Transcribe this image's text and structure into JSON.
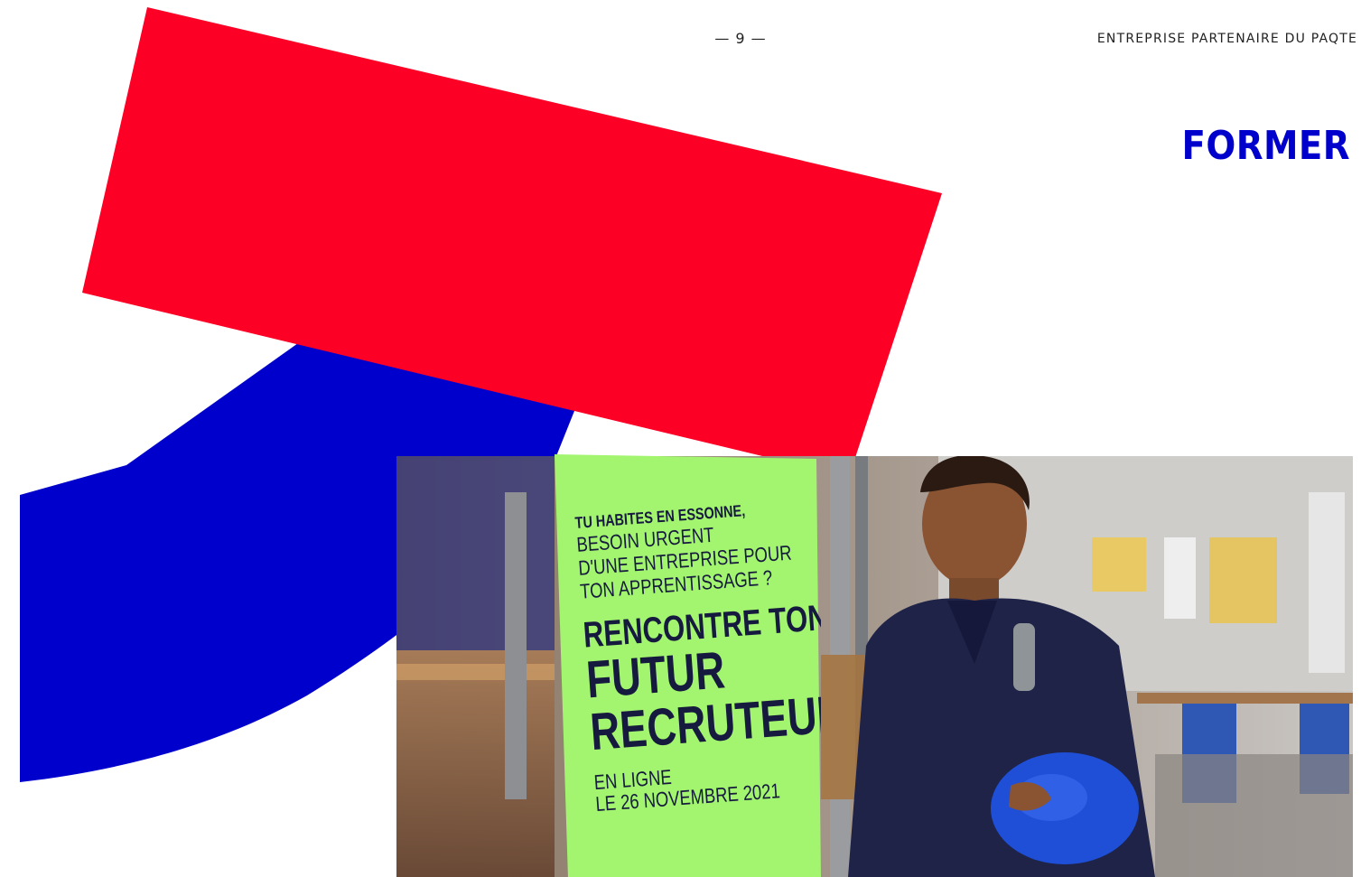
{
  "header": {
    "page_number": "— 9 —",
    "running_title": "ENTREPRISE PARTENAIRE DU PAQTE"
  },
  "section": {
    "title": "FORMER"
  },
  "colors": {
    "blue": "#0000cc",
    "red": "#fc0026",
    "poster_green": "#a3f56f",
    "poster_ink": "#161a3e"
  },
  "poster": {
    "kicker": "TU HABITES EN ESSONNE,",
    "question_lines": [
      "BESOIN URGENT",
      "D'UNE ENTREPRISE POUR",
      "TON APPRENTISSAGE ?"
    ],
    "headline": "RENCONTRE TON",
    "headline_big_lines": [
      "FUTUR",
      "RECRUTEUR"
    ],
    "date_lines": [
      "EN LIGNE",
      "LE 26 NOVEMBRE 2021"
    ]
  }
}
